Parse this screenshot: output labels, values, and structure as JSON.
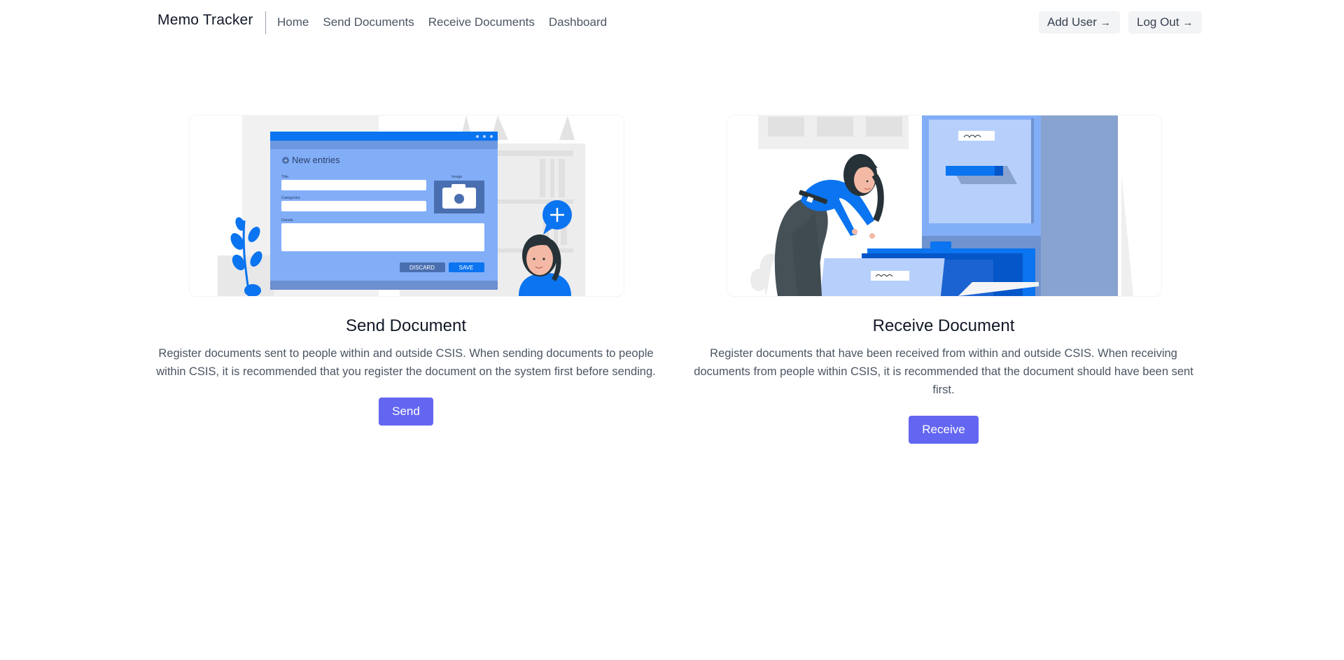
{
  "header": {
    "brand": "Memo Tracker",
    "nav": [
      "Home",
      "Send Documents",
      "Receive Documents",
      "Dashboard"
    ],
    "add_user_label": "Add User",
    "log_out_label": "Log Out",
    "arrow_icon": "arrow-right-icon"
  },
  "send_card": {
    "title": "Send Document",
    "description": "Register documents sent to people within and outside CSIS. When sending documents to people within CSIS, it is recommended that you register the document on the system first before sending.",
    "button": "Send",
    "illustration": {
      "heading": "New entries",
      "field_title": "Title",
      "field_categories": "Categories",
      "field_image": "Image",
      "field_details": "Details",
      "discard": "DISCARD",
      "save": "SAVE"
    }
  },
  "receive_card": {
    "title": "Receive Document",
    "description": "Register documents that have been received from within and outside CSIS. When receiving documents from people within CSIS, it is recommended that the document should have been sent first.",
    "button": "Receive"
  },
  "colors": {
    "accent": "#6366f1",
    "illustration_blue": "#0b74f0"
  }
}
